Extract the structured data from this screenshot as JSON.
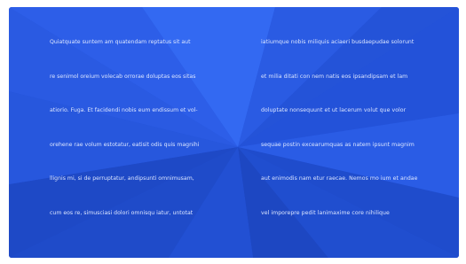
{
  "hero": {
    "left_column": [
      "Quiatquate suntem am quatendam reptatus sit aut",
      "re senimol oreium volecab orrorae doluptas eos sitas",
      "atiorio. Fuga. Et facidendi nobis eum endissum et vol-",
      "orehene rae volum estotatur, eatisit odis quis magnihi",
      "llignis mi, si de perruptatur, andipsunti omnimusam,",
      "cum eos re, simusciasi dolori omnisqu iatur, untotat"
    ],
    "right_column": [
      "iatiumque nobis miliquis aciaeri busdaepudae solorunt",
      "et milia ditati con nem natis eos ipsandipsam et lam",
      "doluptate nonsequunt et ut lacerum volut que volor",
      "sequae postin excearumquas as natem ipsunt magnim",
      "aut enimodis nam etur raecae. Nemos mo ium et andae",
      "vel imporepre pedit lanimaxime core nihilique"
    ]
  },
  "colors": {
    "panel_base": "#2554dc",
    "text": "#dce6ff",
    "facet_light": "#2f63f0",
    "facet_dark": "#1c45c4"
  }
}
